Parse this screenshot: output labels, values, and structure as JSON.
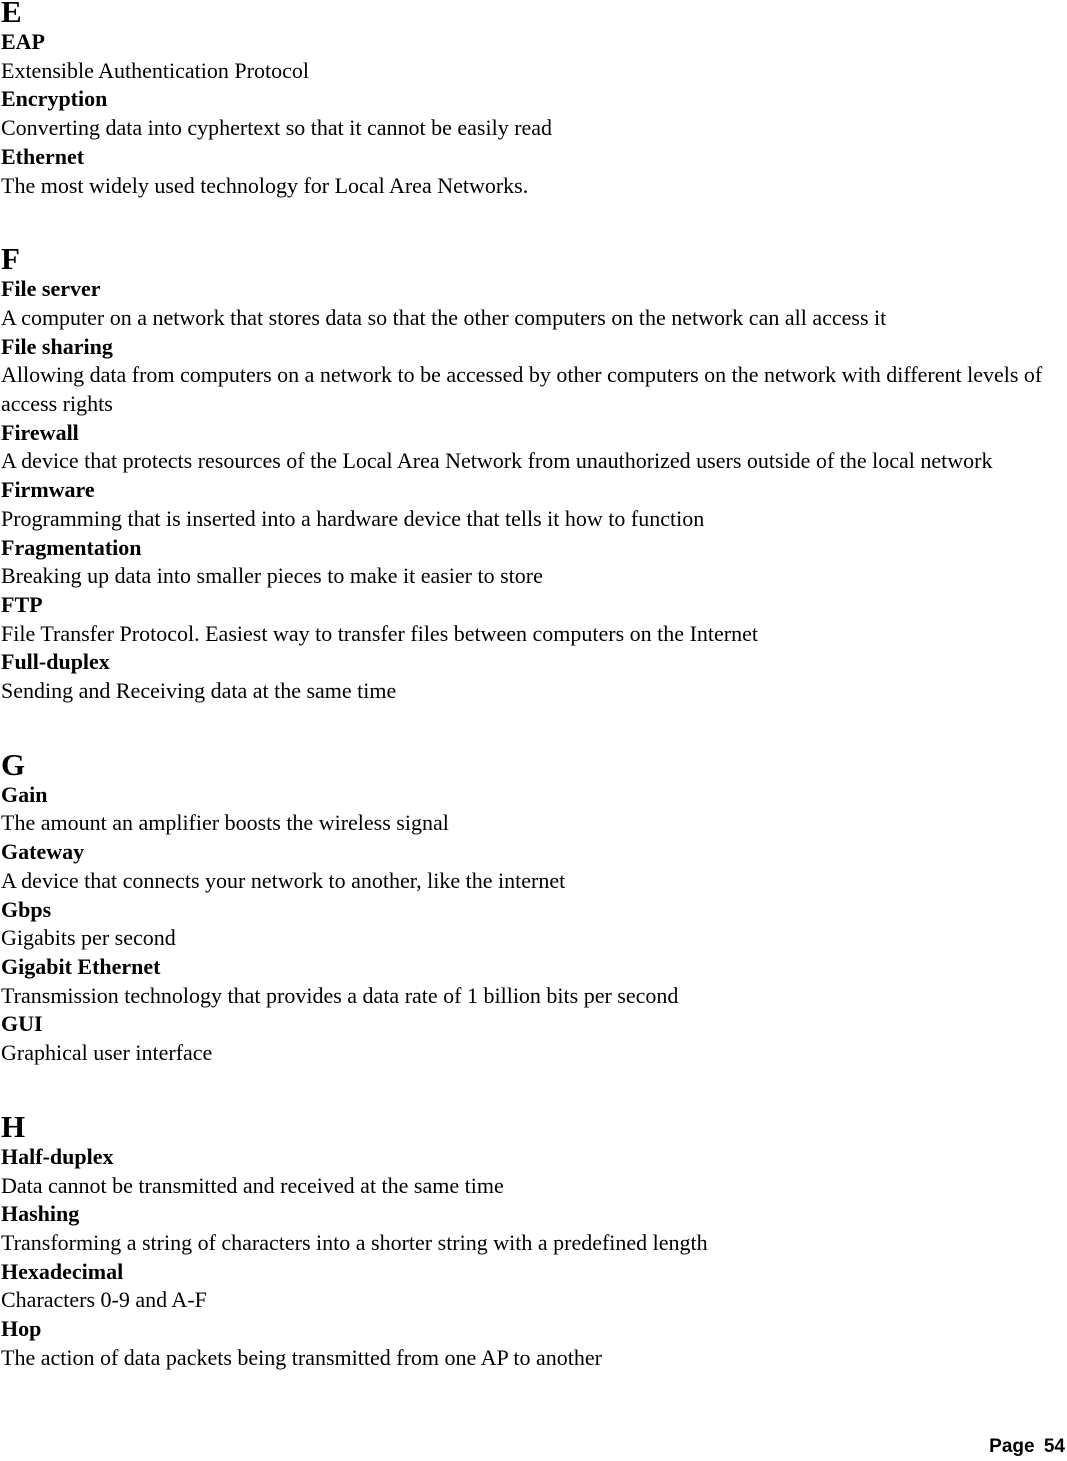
{
  "sections": [
    {
      "letter": "E",
      "entries": [
        {
          "term": "EAP",
          "definition": "Extensible Authentication Protocol"
        },
        {
          "term": "Encryption",
          "definition": "Converting data into cyphertext so that it cannot be easily read"
        },
        {
          "term": "Ethernet",
          "definition": "The most widely used technology for Local Area Networks."
        }
      ]
    },
    {
      "letter": "F",
      "entries": [
        {
          "term": "File server",
          "definition": "A computer on a network that stores data so that the other computers on the network can all access it"
        },
        {
          "term": "File sharing",
          "definition": "Allowing data from computers on a network to be accessed by other computers on the network with different levels of access rights"
        },
        {
          "term": "Firewall",
          "definition": "A device that protects resources of the Local Area Network from unauthorized users outside of the local network"
        },
        {
          "term": "Firmware",
          "definition": "Programming that is inserted into a hardware device that tells it how to function"
        },
        {
          "term": "Fragmentation",
          "definition": "Breaking up data into smaller pieces to make it easier to store"
        },
        {
          "term": "FTP",
          "definition": "File Transfer Protocol. Easiest way to transfer files between computers on the Internet"
        },
        {
          "term": "Full-duplex",
          "definition": "Sending and Receiving data at the same time"
        }
      ]
    },
    {
      "letter": "G",
      "entries": [
        {
          "term": "Gain",
          "definition": "The amount an amplifier boosts the wireless signal"
        },
        {
          "term": "Gateway",
          "definition": "A device that connects your network to another, like the internet"
        },
        {
          "term": "Gbps",
          "definition": "Gigabits per second"
        },
        {
          "term": "Gigabit Ethernet",
          "definition": "Transmission technology that provides a data rate of 1 billion bits per second"
        },
        {
          "term": "GUI",
          "definition": "Graphical user interface"
        }
      ]
    },
    {
      "letter": "H",
      "entries": [
        {
          "term": "Half-duplex",
          "definition": "Data cannot be transmitted and received at the same time"
        },
        {
          "term": "Hashing",
          "definition": "Transforming a string of characters into a shorter string with a predefined length"
        },
        {
          "term": "Hexadecimal",
          "definition": "Characters 0-9 and A-F"
        },
        {
          "term": "Hop",
          "definition": "The action of data packets being transmitted from one AP to another"
        }
      ]
    }
  ],
  "footer": {
    "page_label": "Page 54"
  }
}
